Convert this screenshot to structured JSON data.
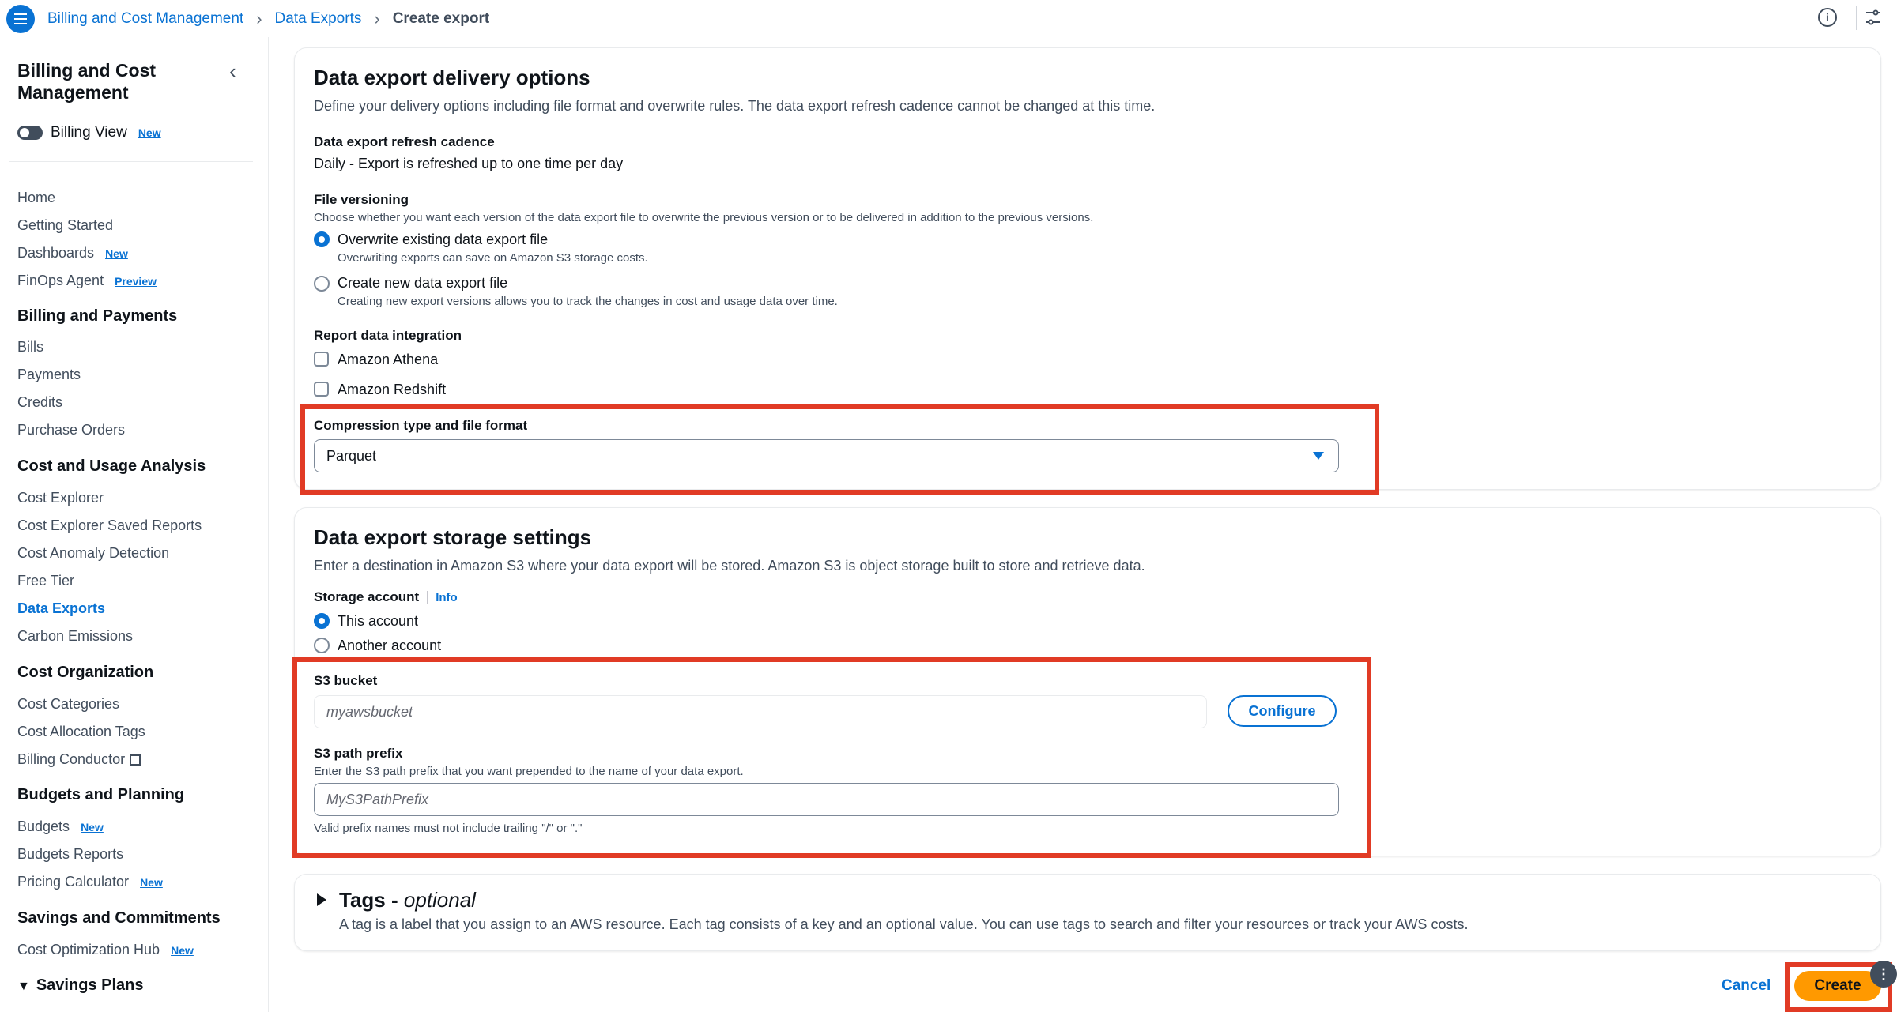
{
  "header": {
    "breadcrumbs": [
      "Billing and Cost Management",
      "Data Exports"
    ],
    "current": "Create export"
  },
  "sidebar": {
    "title": "Billing and Cost Management",
    "billing_view": "Billing View",
    "billing_view_badge": "New",
    "items": {
      "home": "Home",
      "getting_started": "Getting Started",
      "dashboards": "Dashboards",
      "dashboards_badge": "New",
      "finops": "FinOps Agent",
      "finops_badge": "Preview",
      "billing_payments": "Billing and Payments",
      "bills": "Bills",
      "payments": "Payments",
      "credits": "Credits",
      "purchase_orders": "Purchase Orders",
      "cost_usage": "Cost and Usage Analysis",
      "cost_explorer": "Cost Explorer",
      "cost_explorer_saved": "Cost Explorer Saved Reports",
      "cost_anomaly": "Cost Anomaly Detection",
      "free_tier": "Free Tier",
      "data_exports": "Data Exports",
      "carbon": "Carbon Emissions",
      "cost_org": "Cost Organization",
      "cost_categories": "Cost Categories",
      "cost_alloc_tags": "Cost Allocation Tags",
      "billing_conductor": "Billing Conductor",
      "budgets_planning": "Budgets and Planning",
      "budgets": "Budgets",
      "budgets_badge": "New",
      "budgets_reports": "Budgets Reports",
      "pricing_calc": "Pricing Calculator",
      "pricing_badge": "New",
      "savings": "Savings and Commitments",
      "cost_opt_hub": "Cost Optimization Hub",
      "cost_opt_badge": "New",
      "savings_plans": "Savings Plans"
    }
  },
  "delivery": {
    "title": "Data export delivery options",
    "description": "Define your delivery options including file format and overwrite rules. The data export refresh cadence cannot be changed at this time.",
    "cadence_label": "Data export refresh cadence",
    "cadence_value": "Daily - Export is refreshed up to one time per day",
    "versioning_label": "File versioning",
    "versioning_desc": "Choose whether you want each version of the data export file to overwrite the previous version or to be delivered in addition to the previous versions.",
    "overwrite_label": "Overwrite existing data export file",
    "overwrite_desc": "Overwriting exports can save on Amazon S3 storage costs.",
    "new_label": "Create new data export file",
    "new_desc": "Creating new export versions allows you to track the changes in cost and usage data over time.",
    "integration_label": "Report data integration",
    "athena": "Amazon Athena",
    "redshift": "Amazon Redshift",
    "compression_label": "Compression type and file format",
    "compression_value": "Parquet"
  },
  "storage": {
    "title": "Data export storage settings",
    "description": "Enter a destination in Amazon S3 where your data export will be stored. Amazon S3 is object storage built to store and retrieve data.",
    "account_label": "Storage account",
    "info": "Info",
    "this_account": "This account",
    "another_account": "Another account",
    "bucket_label": "S3 bucket",
    "bucket_placeholder": "myawsbucket",
    "configure": "Configure",
    "prefix_label": "S3 path prefix",
    "prefix_desc": "Enter the S3 path prefix that you want prepended to the name of your data export.",
    "prefix_placeholder": "MyS3PathPrefix",
    "prefix_hint": "Valid prefix names must not include trailing \"/\" or \".\""
  },
  "tags": {
    "title": "Tags - ",
    "optional": "optional",
    "description": "A tag is a label that you assign to an AWS resource. Each tag consists of a key and an optional value. You can use tags to search and filter your resources or track your AWS costs."
  },
  "footer": {
    "cancel": "Cancel",
    "create": "Create"
  },
  "colors": {
    "accent": "#0972d3",
    "highlight": "#e13b25",
    "primary_button": "#ff9900"
  }
}
